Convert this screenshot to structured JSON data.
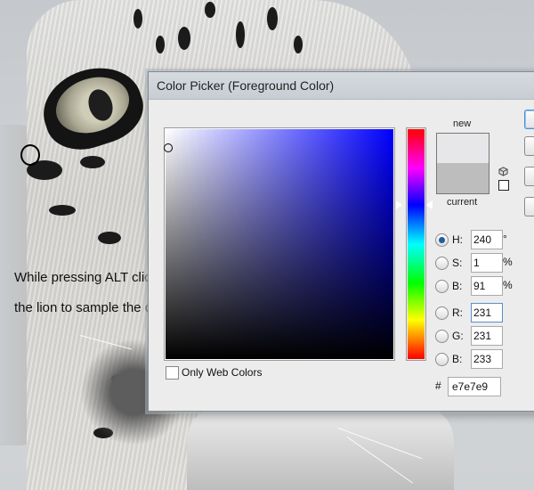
{
  "instruction": {
    "line1": "While pressing ALT click on a part of",
    "line2": "the lion to sample the color"
  },
  "dialog": {
    "title": "Color Picker (Foreground Color)",
    "swatch": {
      "new_label": "new",
      "current_label": "current",
      "new_color": "#e7e7e9",
      "current_color": "#bdbdbd"
    },
    "only_web_colors_label": "Only Web Colors",
    "fields": {
      "H": {
        "label": "H:",
        "value": "240",
        "unit": "°",
        "selected": true
      },
      "S": {
        "label": "S:",
        "value": "1",
        "unit": "%"
      },
      "B": {
        "label": "B:",
        "value": "91",
        "unit": "%"
      },
      "R": {
        "label": "R:",
        "value": "231"
      },
      "G": {
        "label": "G:",
        "value": "231"
      },
      "B2": {
        "label": "B:",
        "value": "233"
      }
    },
    "hex_prefix": "#",
    "hex_value": "e7e7e9"
  },
  "colors": {
    "field_hue": "#0000ff",
    "accent": "#1f5d9c"
  }
}
